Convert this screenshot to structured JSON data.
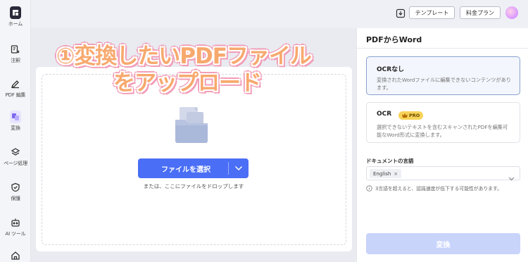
{
  "sidebar": {
    "items": [
      {
        "label": "ホーム",
        "icon": "home-logo-icon"
      },
      {
        "label": "注釈",
        "icon": "annotate-icon"
      },
      {
        "label": "PDF 編集",
        "icon": "edit-icon"
      },
      {
        "label": "変換",
        "icon": "convert-icon"
      },
      {
        "label": "ページ処理",
        "icon": "layers-icon"
      },
      {
        "label": "保護",
        "icon": "shield-icon"
      },
      {
        "label": "AI ツール",
        "icon": "robot-icon"
      },
      {
        "label": "",
        "icon": "house-icon"
      }
    ]
  },
  "topbar": {
    "template_label": "テンプレート",
    "pricing_label": "料金プラン"
  },
  "overlay": {
    "line1": "①変換したいPDFファイル",
    "line2": "をアップロード"
  },
  "upload": {
    "select_button_label": "ファイルを選択",
    "hint": "または、ここにファイルをドロップします"
  },
  "panel": {
    "title": "PDFからWord",
    "options": [
      {
        "title": "OCRなし",
        "description": "変換されたWordファイルに編集できないコンテンツがあります。"
      },
      {
        "title": "OCR",
        "badge": "PRO",
        "description": "選択できないテキストを含むスキャンされたPDFを編集可能なWord形式に変換します。"
      }
    ],
    "language_label": "ドキュメントの言語",
    "language_value": "English",
    "note": "3言語を超えると、認識速度が低下する可能性があります。",
    "convert_label": "変換"
  },
  "colors": {
    "accent": "#4a6ef5",
    "convert_disabled": "#c9d4fb",
    "overlay_fill": "#f7a96e",
    "overlay_outline": "#f29db7",
    "pro_badge": "#f8d35a"
  }
}
